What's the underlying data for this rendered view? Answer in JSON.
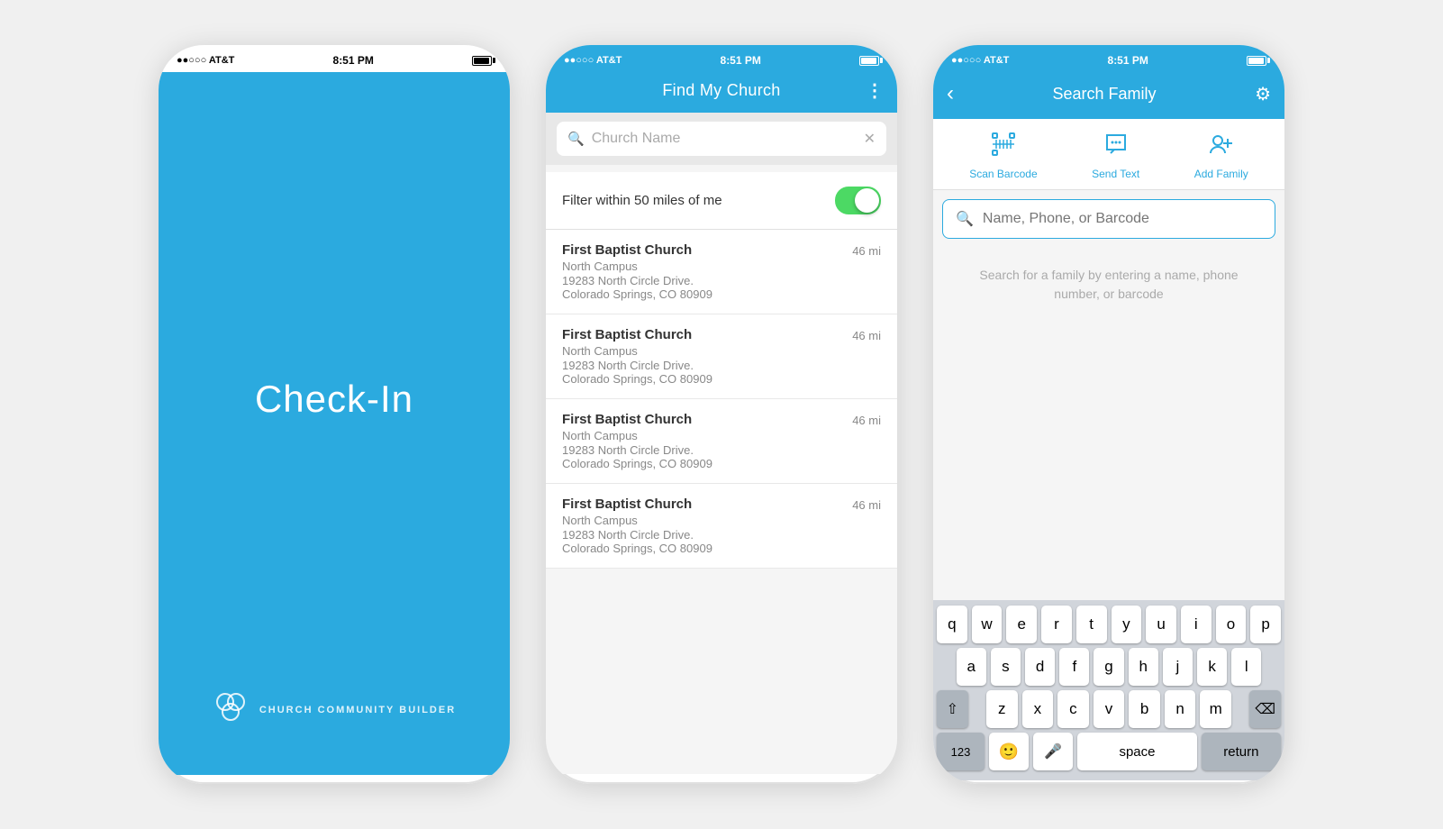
{
  "phone1": {
    "status": {
      "carrier": "●●○○○ AT&T",
      "time": "8:51 PM",
      "battery": ""
    },
    "title": "Check-In",
    "logo_name": "CHURCH COMMUNITY BUILDER"
  },
  "phone2": {
    "status": {
      "carrier": "●●○○○ AT&T",
      "time": "8:51 PM"
    },
    "header_title": "Find My Church",
    "search_placeholder": "Church Name",
    "filter_label": "Filter within 50 miles of me",
    "churches": [
      {
        "name": "First Baptist Church",
        "campus": "North Campus",
        "address1": "19283 North Circle Drive.",
        "address2": "Colorado Springs, CO 80909",
        "distance": "46 mi"
      },
      {
        "name": "First Baptist Church",
        "campus": "North Campus",
        "address1": "19283 North Circle Drive.",
        "address2": "Colorado Springs, CO 80909",
        "distance": "46 mi"
      },
      {
        "name": "First Baptist Church",
        "campus": "North Campus",
        "address1": "19283 North Circle Drive.",
        "address2": "Colorado Springs, CO 80909",
        "distance": "46 mi"
      },
      {
        "name": "First Baptist Church",
        "campus": "North Campus",
        "address1": "19283 North Circle Drive.",
        "address2": "Colorado Springs, CO 80909",
        "distance": "46 mi"
      }
    ]
  },
  "phone3": {
    "status": {
      "carrier": "●●○○○ AT&T",
      "time": "8:51 PM"
    },
    "header_title": "Search Family",
    "scan_label": "Scan Barcode",
    "send_text_label": "Send Text",
    "add_family_label": "Add Family",
    "search_placeholder": "Name, Phone, or Barcode",
    "search_hint": "Search for a family by entering a name, phone number, or barcode",
    "keyboard": {
      "row1": [
        "q",
        "w",
        "e",
        "r",
        "t",
        "y",
        "u",
        "i",
        "o",
        "p"
      ],
      "row2": [
        "a",
        "s",
        "d",
        "f",
        "g",
        "h",
        "j",
        "k",
        "l"
      ],
      "row3": [
        "z",
        "x",
        "c",
        "v",
        "b",
        "n",
        "m"
      ],
      "space_label": "space",
      "return_label": "return",
      "num_label": "123"
    }
  }
}
